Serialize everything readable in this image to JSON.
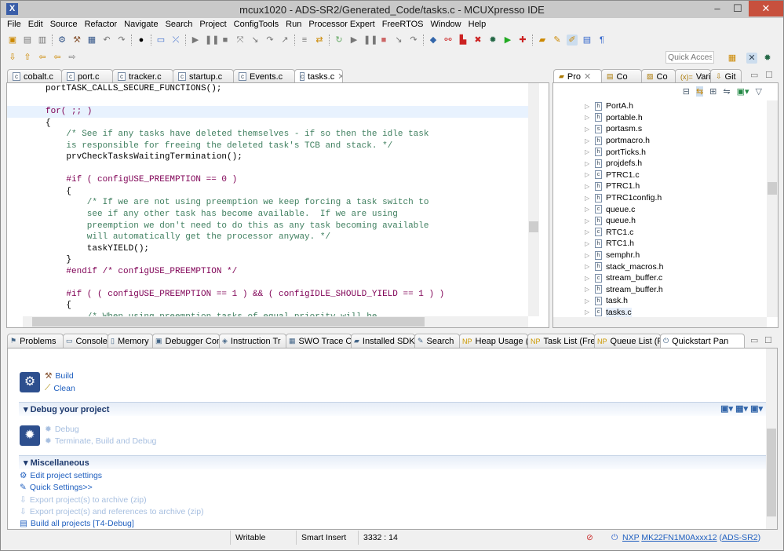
{
  "window": {
    "title": "mcux1020 - ADS-SR2/Generated_Code/tasks.c - MCUXpresso IDE",
    "minimize": "‒",
    "maximize": "☐",
    "close": "✕"
  },
  "menu": [
    "File",
    "Edit",
    "Source",
    "Refactor",
    "Navigate",
    "Search",
    "Project",
    "ConfigTools",
    "Run",
    "Processor Expert",
    "FreeRTOS",
    "Window",
    "Help"
  ],
  "quick_access": {
    "placeholder": "Quick Access"
  },
  "editor": {
    "tabs": [
      "cobalt.c",
      "port.c",
      "tracker.c",
      "startup.c",
      "Events.c",
      "tasks.c"
    ],
    "active_tab": "tasks.c",
    "lines": [
      "portTASK_CALLS_SECURE_FUNCTIONS();",
      "",
      "for( ;; )",
      "{",
      "    /* See if any tasks have deleted themselves - if so then the idle task",
      "    is responsible for freeing the deleted task's TCB and stack. */",
      "    prvCheckTasksWaitingTermination();",
      "",
      "    #if ( configUSE_PREEMPTION == 0 )",
      "    {",
      "        /* If we are not using preemption we keep forcing a task switch to",
      "        see if any other task has become available.  If we are using",
      "        preemption we don't need to do this as any task becoming available",
      "        will automatically get the processor anyway. */",
      "        taskYIELD();",
      "    }",
      "    #endif /* configUSE_PREEMPTION */",
      "",
      "    #if ( ( configUSE_PREEMPTION == 1 ) && ( configIDLE_SHOULD_YIELD == 1 ) )",
      "    {",
      "        /* When using preemption tasks of equal priority will be"
    ]
  },
  "explorer": {
    "tabs": [
      "Pro",
      "Co",
      "Co",
      "Vari",
      "Git"
    ],
    "files": [
      "PortA.h",
      "portable.h",
      "portasm.s",
      "portmacro.h",
      "portTicks.h",
      "projdefs.h",
      "PTRC1.c",
      "PTRC1.h",
      "PTRC1config.h",
      "queue.c",
      "queue.h",
      "RTC1.c",
      "RTC1.h",
      "semphr.h",
      "stack_macros.h",
      "stream_buffer.c",
      "stream_buffer.h",
      "task.h",
      "tasks.c"
    ]
  },
  "bottom_tabs": [
    "Problems",
    "Console",
    "Memory",
    "Debugger Con",
    "Instruction Tr",
    "SWO Trace Co",
    "Installed SDKs",
    "Search",
    "Heap Usage (F",
    "Task List (Free",
    "Queue List (Fre",
    "Quickstart Pan"
  ],
  "quickstart": {
    "build": "Build",
    "clean": "Clean",
    "debug_section": "Debug your project",
    "debug": "Debug",
    "terminate": "Terminate, Build and Debug",
    "misc_section": "Miscellaneous",
    "misc": [
      "Edit project settings",
      "Quick Settings>>",
      "Export project(s) to archive (zip)",
      "Export project(s) and references to archive (zip)",
      "Build all projects [T4-Debug]"
    ]
  },
  "status": {
    "writable": "Writable",
    "insert": "Smart Insert",
    "position": "3332 : 14",
    "nxp": "NXP",
    "device": "MK22FN1M0Axxx12",
    "project": "ADS-SR2",
    "open_paren": "(",
    "close_paren": ")"
  }
}
